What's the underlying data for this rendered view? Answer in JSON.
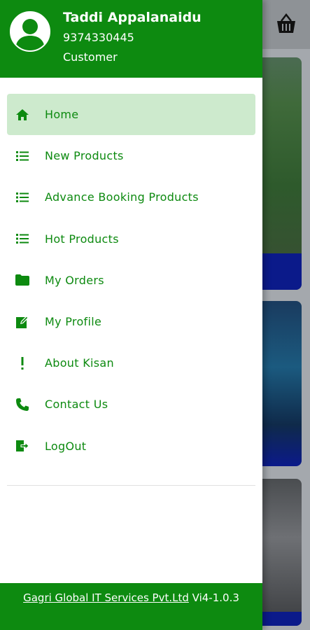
{
  "user": {
    "name": "Taddi Appalanaidu",
    "phone": "9374330445",
    "role": "Customer"
  },
  "menu": {
    "items": [
      {
        "label": "Home",
        "icon": "home-icon",
        "active": true
      },
      {
        "label": "New Products",
        "icon": "list-icon"
      },
      {
        "label": "Advance Booking Products",
        "icon": "list-icon"
      },
      {
        "label": "Hot Products",
        "icon": "list-icon"
      },
      {
        "label": "My Orders",
        "icon": "folder-icon"
      },
      {
        "label": "My Profile",
        "icon": "edit-icon"
      },
      {
        "label": "About Kisan",
        "icon": "exclamation-icon"
      },
      {
        "label": "Contact Us",
        "icon": "phone-icon"
      },
      {
        "label": "LogOut",
        "icon": "logout-icon"
      }
    ]
  },
  "footer": {
    "company": "Gagri Global IT Services Pvt.Ltd",
    "version": "Vi4-1.0.3"
  },
  "colors": {
    "brand_green": "#0d8a10",
    "active_bg": "#cdeacd",
    "band_blue": "#0b1a8a"
  }
}
